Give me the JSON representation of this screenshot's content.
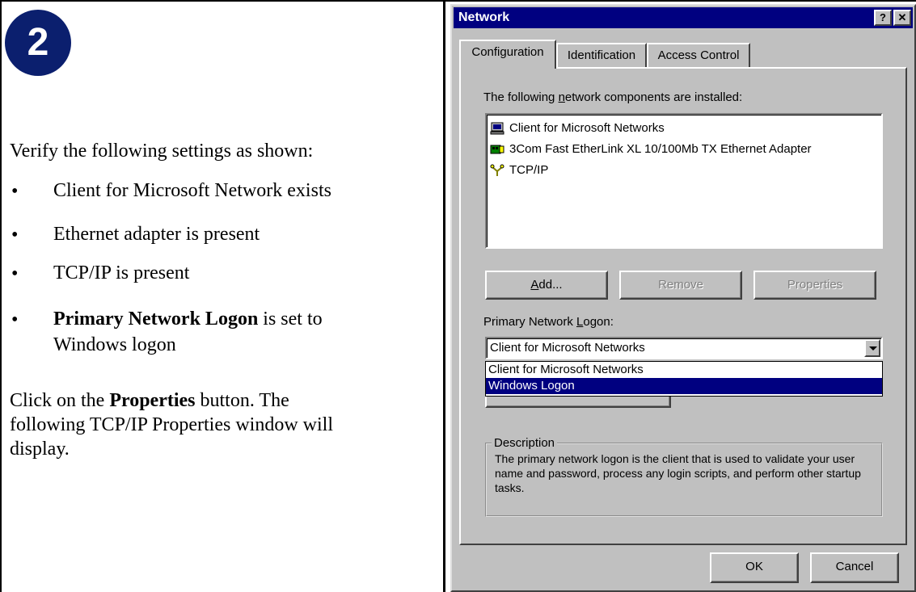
{
  "left": {
    "step_number": "2",
    "intro": "Verify the following settings as shown:",
    "bullet": "•",
    "bullets": [
      "Client for Microsoft Network exists",
      "Ethernet adapter is present",
      "TCP/IP is present"
    ],
    "logon_bullet_bold": "Primary Network Logon",
    "logon_bullet_rest_1": " is set to",
    "logon_bullet_rest_2": "Windows logon",
    "click_1": "Click on the ",
    "click_bold": "Properties",
    "click_2": " button. The",
    "click_3": "following TCP/IP Properties window will",
    "click_4": "display."
  },
  "dialog": {
    "title": "Network",
    "help_button": "?",
    "close_button": "✕",
    "tabs": [
      "Configuration",
      "Identification",
      "Access Control"
    ],
    "components_label_pre": "The following ",
    "components_label_ul": "n",
    "components_label_post": "etwork components are installed:",
    "components": [
      {
        "label": "Client for Microsoft Networks",
        "icon": "network-client-icon"
      },
      {
        "label": "3Com Fast EtherLink XL 10/100Mb TX Ethernet Adapter",
        "icon": "network-adapter-icon"
      },
      {
        "label": "TCP/IP",
        "icon": "protocol-icon"
      }
    ],
    "add_ul": "A",
    "add_rest": "dd...",
    "remove_label": "Remove",
    "properties_label": "Properties",
    "logon_label_pre": "Primary Network ",
    "logon_label_ul": "L",
    "logon_label_post": "ogon:",
    "logon_value": "Client for Microsoft Networks",
    "logon_options": [
      "Client for Microsoft Networks",
      "Windows Logon"
    ],
    "selected_option_index": 1,
    "description_title": "Description",
    "description_text": "The primary network logon is the client that is used to validate your user name and password, process any login scripts, and perform other startup tasks.",
    "ok_label": "OK",
    "cancel_label": "Cancel",
    "colors": {
      "titlebar": "#000080",
      "face": "#c0c0c0",
      "step_circle": "#0b1f6e"
    }
  }
}
